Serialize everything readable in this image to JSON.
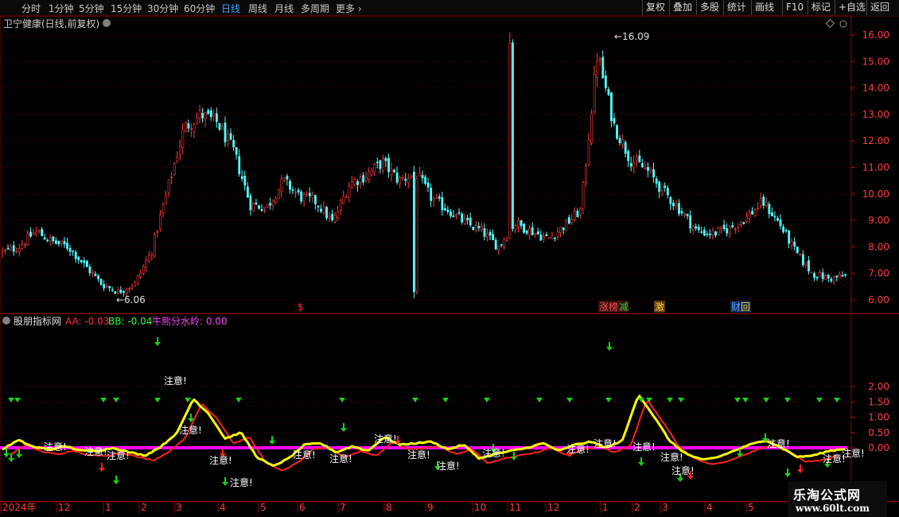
{
  "toolbar": {
    "periods": [
      "分时",
      "1分钟",
      "5分钟",
      "15分钟",
      "30分钟",
      "60分钟",
      "日线",
      "周线",
      "月线",
      "多周期",
      "更多"
    ],
    "active_period": "日线",
    "right_buttons": [
      "复权",
      "叠加",
      "多股",
      "统计",
      "画线",
      "F10",
      "标记",
      "+自选",
      "返回"
    ]
  },
  "main_pane": {
    "title": "卫宁健康(日线,前复权)",
    "high_label": "16.09",
    "low_label": "6.06",
    "events": [
      "$",
      "涨榜",
      "减",
      "激",
      "财",
      "回"
    ]
  },
  "indicator_pane": {
    "name": "股朋指标网",
    "aa_label": "AA:",
    "aa_value": "-0.03",
    "bb_label": "BB:",
    "bb_value": "-0.04",
    "water_label": "牛熊分水岭:",
    "water_value": "0.00",
    "warning_text": "注意!"
  },
  "time_axis": [
    "2024年",
    "12",
    "1",
    "2",
    "3",
    "4",
    "5",
    "6",
    "7",
    "8",
    "9",
    "10",
    "11",
    "12",
    "1",
    "2",
    "3",
    "4",
    "5"
  ],
  "watermark": {
    "name": "乐淘公式网",
    "url": "www.60lt.com"
  },
  "colors": {
    "up": "#ff3c3c",
    "down": "#54ffff",
    "aa_line": "#ffff00",
    "bb_line": "#ff2020",
    "watershed": "#ff00ff",
    "arrow_down": "#19d219",
    "arrow_up": "#ff2020"
  },
  "chart_data": [
    {
      "type": "candlestick",
      "title": "卫宁健康(日线,前复权)",
      "ylim": [
        5.6,
        16.5
      ],
      "yticks": [
        6.0,
        7.0,
        8.0,
        9.0,
        10.0,
        11.0,
        12.0,
        13.0,
        14.0,
        15.0,
        16.0
      ],
      "x": [
        "2024年",
        "12",
        "1",
        "2",
        "3",
        "4",
        "5",
        "6",
        "7",
        "8",
        "9",
        "10",
        "11",
        "12",
        "1",
        "2",
        "3",
        "4",
        "5"
      ],
      "close_path": [
        7.8,
        8.0,
        8.6,
        8.2,
        8.0,
        7.3,
        6.6,
        6.3,
        6.6,
        7.8,
        10.2,
        12.5,
        13.0,
        12.7,
        11.6,
        9.6,
        9.5,
        10.5,
        9.9,
        9.7,
        8.9,
        10.4,
        10.7,
        11.2,
        10.5,
        10.8,
        9.8,
        9.4,
        8.9,
        8.6,
        8.0,
        8.9,
        8.6,
        8.3,
        8.8,
        9.4,
        15.3,
        12.6,
        11.3,
        10.9,
        10.1,
        9.4,
        8.6,
        8.5,
        8.7,
        9.1,
        9.7,
        8.9,
        7.8,
        7.0,
        6.8,
        6.9
      ],
      "high": 16.09,
      "low": 6.06
    },
    {
      "type": "line",
      "title": "股朋指标网",
      "ylim": [
        -0.82,
        2.18
      ],
      "yticks": [
        0.0,
        0.5,
        1.0,
        1.5,
        2.0
      ],
      "series": [
        {
          "name": "AA",
          "last": -0.03,
          "values": [
            -0.05,
            0.25,
            0.02,
            -0.05,
            0.05,
            -0.1,
            -0.1,
            0.0,
            -0.15,
            -0.25,
            0.05,
            0.5,
            1.6,
            1.1,
            0.3,
            0.5,
            -0.3,
            -0.6,
            -0.35,
            0.1,
            0.15,
            -0.15,
            0.05,
            -0.1,
            0.35,
            0.1,
            0.15,
            0.2,
            -0.05,
            0.1,
            -0.35,
            -0.2,
            -0.1,
            0.0,
            0.15,
            -0.1,
            0.1,
            0.2,
            0.0,
            0.25,
            1.75,
            1.0,
            0.2,
            -0.2,
            -0.4,
            -0.3,
            -0.1,
            0.1,
            0.25,
            0.0,
            -0.3,
            -0.25,
            -0.1,
            -0.03
          ]
        },
        {
          "name": "BB",
          "last": -0.04
        },
        {
          "name": "牛熊分水岭",
          "last": 0.0
        }
      ]
    }
  ]
}
